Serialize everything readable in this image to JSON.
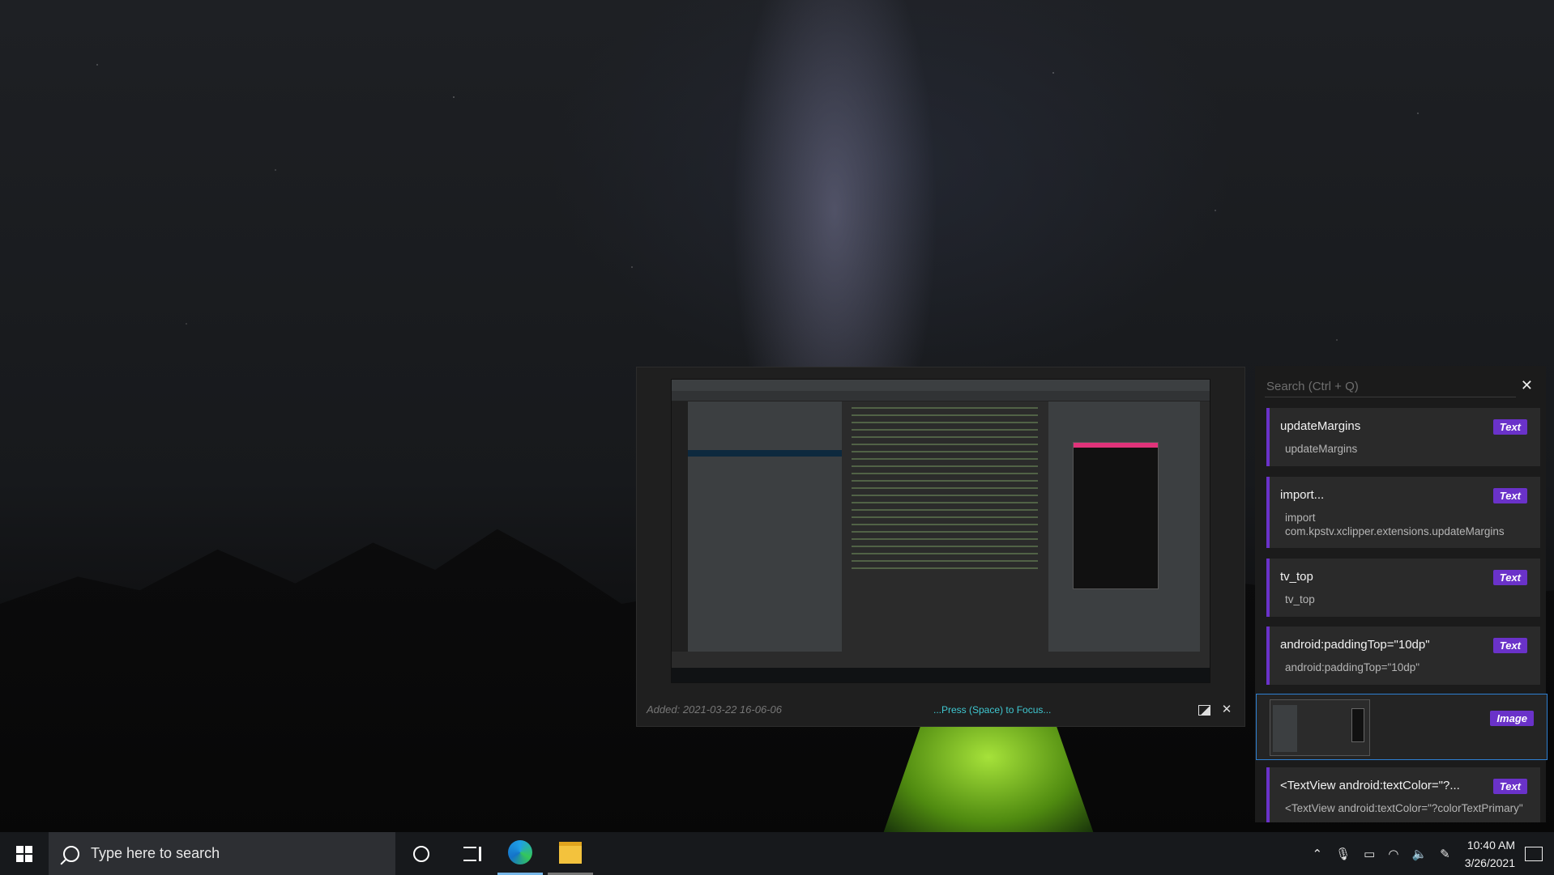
{
  "preview": {
    "added": "Added: 2021-03-22 16-06-06",
    "focus_hint": "...Press (Space) to Focus..."
  },
  "clipboard_panel": {
    "search_placeholder": "Search (Ctrl + Q)",
    "items": [
      {
        "title": "updateMargins",
        "sub": "updateMargins",
        "badge": "Text"
      },
      {
        "title": "import...",
        "sub": "import com.kpstv.xclipper.extensions.updateMargins",
        "badge": "Text"
      },
      {
        "title": "tv_top",
        "sub": "tv_top",
        "badge": "Text"
      },
      {
        "title": "android:paddingTop=\"10dp\"",
        "sub": "android:paddingTop=\"10dp\"",
        "badge": "Text"
      },
      {
        "title": "",
        "sub": "",
        "badge": "Image"
      },
      {
        "title": "<TextView android:textColor=\"?...",
        "sub": "<TextView android:textColor=\"?colorTextPrimary\"",
        "badge": "Text"
      }
    ]
  },
  "taskbar": {
    "search_placeholder": "Type here to search",
    "time": "10:40 AM",
    "date": "3/26/2021"
  },
  "colors": {
    "accent_purple": "#6a32c9",
    "focus_cyan": "#3fc7d0",
    "selection_blue": "#2e7fd1"
  }
}
